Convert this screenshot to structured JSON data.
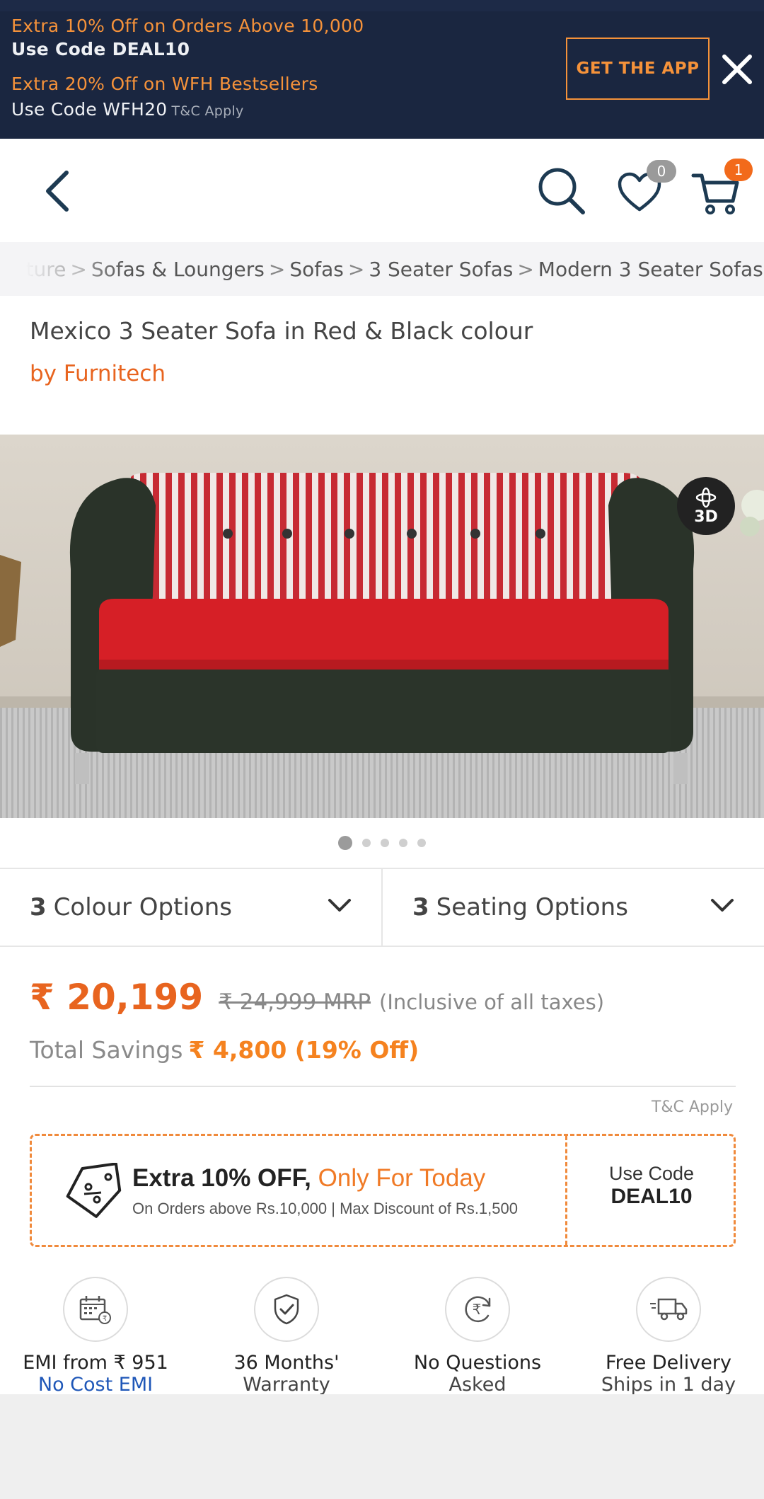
{
  "promo": {
    "line1": "Extra 10% Off on Orders Above 10,000",
    "line2": "Use Code DEAL10",
    "line3": "Extra 20% Off on WFH Bestsellers",
    "line4": "Use Code WFH20",
    "tc": "T&C Apply",
    "get_app": "GET THE APP",
    "close_icon": "close-icon"
  },
  "header": {
    "back_icon": "back-arrow-icon",
    "search_icon": "search-icon",
    "wishlist_icon": "heart-icon",
    "wishlist_count": "0",
    "cart_icon": "cart-icon",
    "cart_count": "1"
  },
  "breadcrumb": [
    "rniture",
    "Sofas & Loungers",
    "Sofas",
    "3 Seater Sofas",
    "Modern 3 Seater Sofas"
  ],
  "product": {
    "title": "Mexico 3 Seater Sofa in Red & Black colour",
    "brand": "by Furnitech",
    "view_3d": "3D"
  },
  "carousel": {
    "count": 5,
    "active": 0
  },
  "options": {
    "colour_count": "3",
    "colour_label": "Colour Options",
    "seating_count": "3",
    "seating_label": "Seating Options"
  },
  "price": {
    "current": "₹ 20,199",
    "mrp": "₹ 24,999 MRP",
    "incl": "(Inclusive of all taxes)",
    "savings_label": "Total Savings",
    "savings_value": "₹ 4,800 (19% Off)",
    "tc": "T&C Apply"
  },
  "coupon": {
    "head_bold": "Extra 10% OFF,",
    "head_today": "Only For Today",
    "sub": "On Orders above Rs.10,000 | Max Discount of Rs.1,500",
    "use_code": "Use Code",
    "code": "DEAL10"
  },
  "features": [
    {
      "icon": "emi-calendar-icon",
      "l1": "EMI from ₹ 951",
      "l2": "No Cost EMI"
    },
    {
      "icon": "warranty-shield-icon",
      "l1": "36 Months'",
      "l2": "Warranty"
    },
    {
      "icon": "rupee-return-icon",
      "l1": "No Questions",
      "l2": "Asked"
    },
    {
      "icon": "delivery-truck-icon",
      "l1": "Free Delivery",
      "l2": "Ships in 1 day"
    }
  ],
  "colors": {
    "banner_bg": "#1a2640",
    "accent_orange": "#e8641f",
    "link_blue": "#1f57b8",
    "badge_gray": "#9a9a9a",
    "badge_orange": "#f26a1b"
  }
}
